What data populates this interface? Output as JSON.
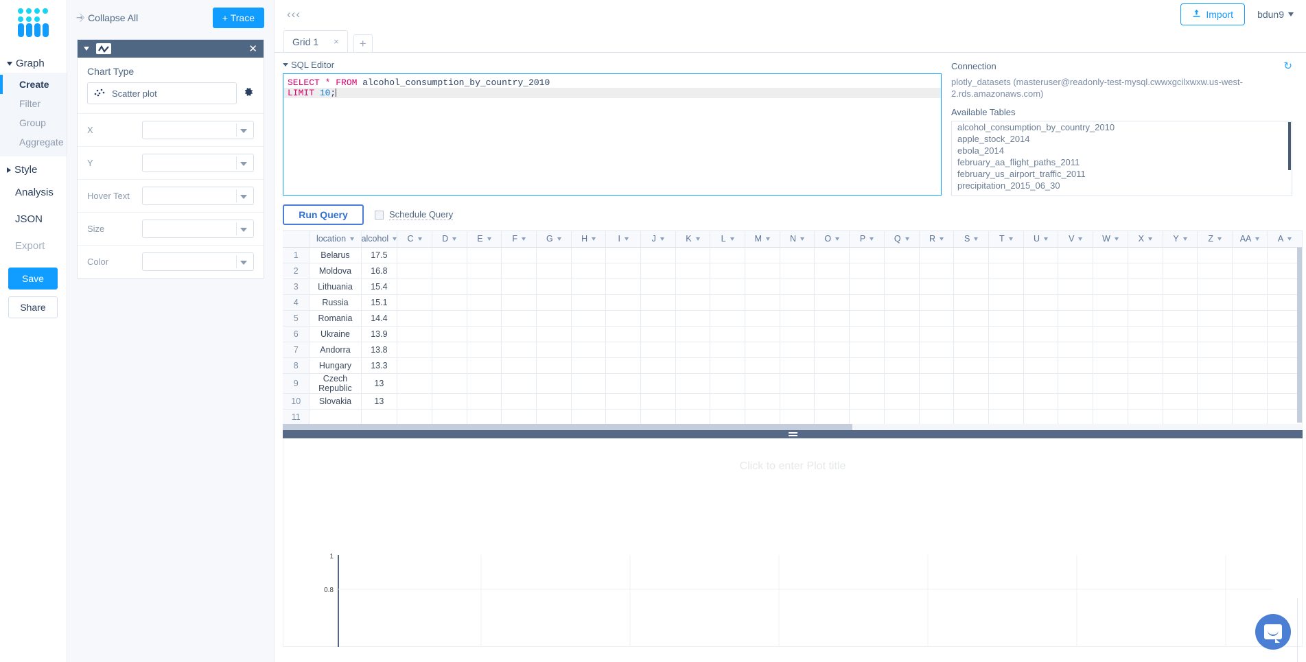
{
  "left_rail": {
    "logo_name": "plotly-logo",
    "graph_group_label": "Graph",
    "graph_items": [
      {
        "label": "Create",
        "active": true
      },
      {
        "label": "Filter",
        "active": false
      },
      {
        "label": "Group",
        "active": false
      },
      {
        "label": "Aggregate",
        "active": false
      }
    ],
    "style_label": "Style",
    "plain_items": [
      {
        "label": "Analysis",
        "dim": false
      },
      {
        "label": "JSON",
        "dim": false
      },
      {
        "label": "Export",
        "dim": true
      }
    ],
    "save_label": "Save",
    "share_label": "Share"
  },
  "sidebar": {
    "collapse_all_label": "Collapse All",
    "add_trace_label": "+ Trace",
    "chart_type_title": "Chart Type",
    "chart_type_value": "Scatter plot",
    "fields": [
      {
        "label": "X",
        "value": ""
      },
      {
        "label": "Y",
        "value": ""
      },
      {
        "label": "Hover Text",
        "value": ""
      },
      {
        "label": "Size",
        "value": ""
      },
      {
        "label": "Color",
        "value": ""
      }
    ]
  },
  "header": {
    "back_chevrons": "‹‹‹",
    "import_label": "Import",
    "user_label": "bdun9"
  },
  "tabs": {
    "items": [
      {
        "label": "Grid 1",
        "close": "×"
      }
    ],
    "add_label": "+"
  },
  "sql_editor": {
    "section_label": "SQL Editor",
    "line1_kw1": "SELECT",
    "line1_star": " * ",
    "line1_kw2": "FROM",
    "line1_table": " alcohol_consumption_by_country_2010",
    "line2_kw": "LIMIT",
    "line2_num": " 10",
    "line2_semi": ";"
  },
  "connection": {
    "title": "Connection",
    "string": "plotly_datasets (masteruser@readonly-test-mysql.cwwxgcilxwxw.us-west-2.rds.amazonaws.com)",
    "available_tables_label": "Available Tables",
    "tables": [
      "alcohol_consumption_by_country_2010",
      "apple_stock_2014",
      "ebola_2014",
      "february_aa_flight_paths_2011",
      "february_us_airport_traffic_2011",
      "precipitation_2015_06_30"
    ]
  },
  "query_bar": {
    "run_label": "Run Query",
    "schedule_label": "Schedule Query",
    "schedule_checked": false
  },
  "grid": {
    "columns": [
      "location",
      "alcohol",
      "C",
      "D",
      "E",
      "F",
      "G",
      "H",
      "I",
      "J",
      "K",
      "L",
      "M",
      "N",
      "O",
      "P",
      "Q",
      "R",
      "S",
      "T",
      "U",
      "V",
      "W",
      "X",
      "Y",
      "Z",
      "AA",
      "A"
    ],
    "rows": [
      {
        "n": "1",
        "location": "Belarus",
        "alcohol": "17.5"
      },
      {
        "n": "2",
        "location": "Moldova",
        "alcohol": "16.8"
      },
      {
        "n": "3",
        "location": "Lithuania",
        "alcohol": "15.4"
      },
      {
        "n": "4",
        "location": "Russia",
        "alcohol": "15.1"
      },
      {
        "n": "5",
        "location": "Romania",
        "alcohol": "14.4"
      },
      {
        "n": "6",
        "location": "Ukraine",
        "alcohol": "13.9"
      },
      {
        "n": "7",
        "location": "Andorra",
        "alcohol": "13.8"
      },
      {
        "n": "8",
        "location": "Hungary",
        "alcohol": "13.3"
      },
      {
        "n": "9",
        "location": "Czech Republic",
        "alcohol": "13"
      },
      {
        "n": "10",
        "location": "Slovakia",
        "alcohol": "13"
      },
      {
        "n": "11",
        "location": "",
        "alcohol": ""
      }
    ]
  },
  "plot": {
    "title_placeholder": "Click to enter Plot title"
  },
  "chart_data": {
    "type": "scatter",
    "title": "",
    "title_placeholder": "Click to enter Plot title",
    "series": [],
    "x": [],
    "y": [],
    "xlabel": "",
    "ylabel": "",
    "ylim": [
      0.4,
      1.05
    ],
    "xlim": [
      0,
      1
    ],
    "ytick_labels": [
      "1",
      "0.8"
    ],
    "ytick_values": [
      1,
      0.8
    ],
    "xtick_labels": [],
    "grid": true,
    "legend": "none"
  },
  "colors": {
    "accent": "#119dff",
    "dark_panel": "#506784",
    "text": "#2a3f5f",
    "muted": "#8d9bae",
    "sql_keyword": "#d5006d",
    "sql_number": "#0b7ad1",
    "intercom": "#4a7fd4"
  },
  "icons": {
    "collapse": "collapse-all-icon",
    "trace_wave": "wave-line-icon",
    "gear": "gear-icon",
    "scatter": "scatter-plot-icon",
    "import": "upload-icon",
    "refresh": "refresh-icon",
    "chat": "chat-bubble-icon"
  }
}
